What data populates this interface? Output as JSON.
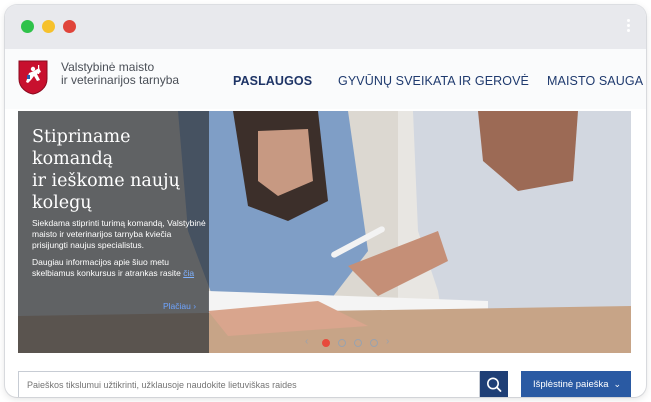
{
  "browser": {
    "controls": [
      "close",
      "minimize",
      "maximize"
    ],
    "menu_icon": "kebab-menu-icon"
  },
  "header": {
    "logo_icon": "lithuania-coat-of-arms-icon",
    "brand_line1": "Valstybinė maisto",
    "brand_line2": "ir veterinarijos tarnyba",
    "nav": [
      {
        "label": "PASLAUGOS",
        "active": true
      },
      {
        "label": "GYVŪNŲ SVEIKATA IR GEROVĖ",
        "active": false
      },
      {
        "label": "MAISTO SAUGA",
        "active": false
      }
    ]
  },
  "hero": {
    "title_line1": "Stipriname komandą",
    "title_line2": "ir ieškome naujų",
    "title_line3": "kolegų",
    "paragraph1": "Siekdama stiprinti turimą komandą, Valstybinė maisto ir veterinarijos tarnyba kviečia prisijungti naujus specialistus.",
    "paragraph2": "Daugiau informacijos apie šiuo metu skelbiamus konkursus ir atrankas rasite",
    "link_label": "čia",
    "more_label": "Plačiau ›",
    "slide_count": 4,
    "active_slide": 1
  },
  "search": {
    "placeholder": "Paieškos tikslumui užtikrinti, užklausoje naudokite lietuviškas raides",
    "button_icon": "search-icon",
    "advanced_label": "Išplėstinė paieška",
    "advanced_icon": "chevron-down-icon"
  },
  "colors": {
    "navy": "#1f3f76",
    "accent_blue": "#2a5aa3",
    "accent_red": "#e74a3c",
    "chrome": "#e8e9ed"
  }
}
